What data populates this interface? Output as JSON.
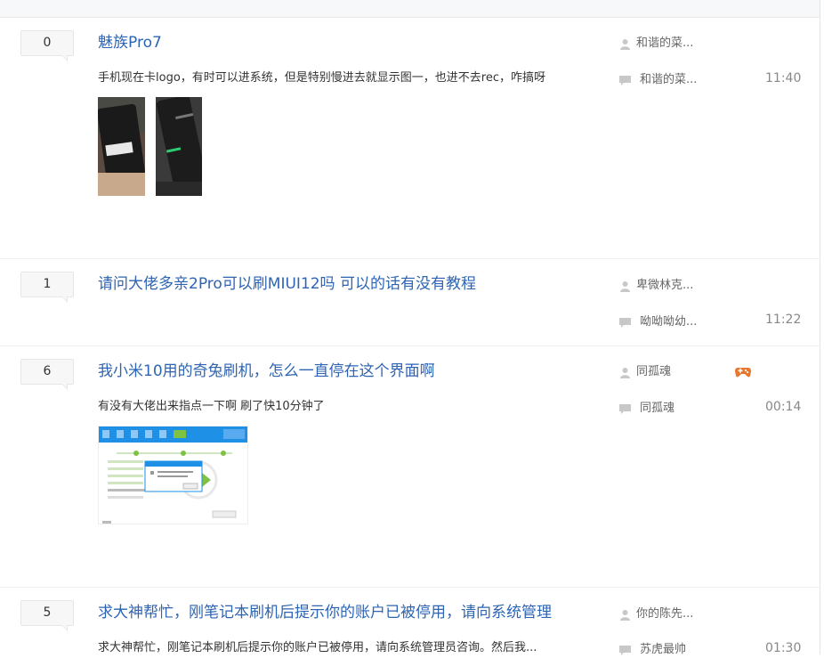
{
  "posts": [
    {
      "replies": "0",
      "title": "魅族Pro7",
      "excerpt": "手机现在卡logo，有时可以进系统，但是特别慢进去就显示图一，也进不去rec，咋搞呀",
      "author": "和谐的菜...",
      "last_replier": "和谐的菜...",
      "time": "11:40"
    },
    {
      "replies": "1",
      "title": "请问大佬多亲2Pro可以刷MIUI12吗 可以的话有没有教程",
      "excerpt": "",
      "author": "卑微林克...",
      "last_replier": "呦呦呦幼...",
      "time": "11:22"
    },
    {
      "replies": "6",
      "title": "我小米10用的奇兔刷机，怎么一直停在这个界面啊",
      "excerpt": "有没有大佬出来指点一下啊 刷了快10分钟了",
      "author": "同孤魂",
      "last_replier": "同孤魂",
      "time": "00:14"
    },
    {
      "replies": "5",
      "title": "求大神帮忙，刚笔记本刷机后提示你的账户已被停用，请向系统管理",
      "excerpt": "求大神帮忙，刚笔记本刷机后提示你的账户已被停用，请向系统管理员咨询。然后我...",
      "author": "你的陈先...",
      "last_replier": "苏虎最帅",
      "time": "01:30"
    }
  ],
  "colors": {
    "title": "#2d64b3",
    "meta": "#666666",
    "icon": "#c8c8c8"
  },
  "icons": {
    "author": "user-icon",
    "replier": "comment-icon",
    "badge": "game-controller-icon"
  }
}
